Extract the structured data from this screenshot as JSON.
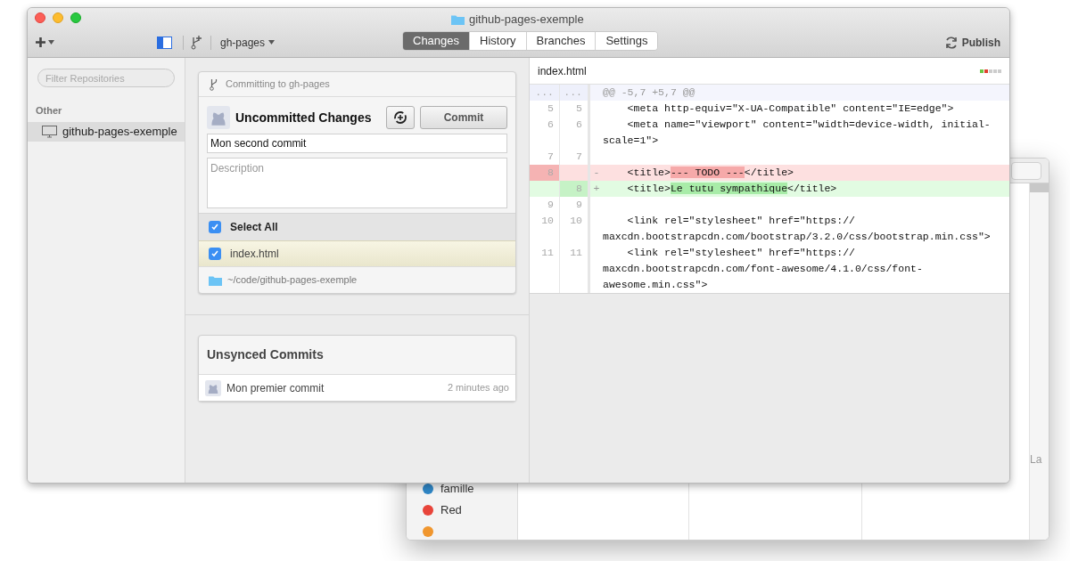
{
  "background_window": {
    "tags": [
      {
        "label": "famille",
        "color": "#2f86c6"
      },
      {
        "label": "Red",
        "color": "#e8443a"
      },
      {
        "color": "#f0962e"
      }
    ],
    "column_text": "La"
  },
  "window": {
    "title": "github-pages-exemple"
  },
  "toolbar": {
    "branch": "gh-pages",
    "tabs": [
      {
        "label": "Changes",
        "selected": true
      },
      {
        "label": "History",
        "selected": false
      },
      {
        "label": "Branches",
        "selected": false
      },
      {
        "label": "Settings",
        "selected": false
      }
    ],
    "publish": "Publish"
  },
  "sidebar": {
    "filter_placeholder": "Filter Repositories",
    "section": "Other",
    "items": [
      {
        "label": "github-pages-exemple",
        "selected": true
      }
    ]
  },
  "commit_panel": {
    "header": "Committing to gh-pages",
    "title": "Uncommitted Changes",
    "commit_button": "Commit",
    "summary": "Mon second commit",
    "description_placeholder": "Description",
    "select_all": {
      "label": "Select All",
      "checked": true
    },
    "files": [
      {
        "name": "index.html",
        "checked": true,
        "selected": true
      }
    ],
    "path": "~/code/github-pages-exemple"
  },
  "unsynced": {
    "title": "Unsynced Commits",
    "commits": [
      {
        "message": "Mon premier commit",
        "time": "2 minutes ago"
      }
    ]
  },
  "diff": {
    "file": "index.html",
    "rows": [
      {
        "kind": "hunk",
        "old": "...",
        "new": "...",
        "lines": [
          [
            {
              "text": "@@ -5,7 +5,7 @@"
            }
          ]
        ]
      },
      {
        "kind": "context",
        "old": "5",
        "new": "5",
        "lines": [
          [
            {
              "text": "    <meta http-equiv=\"X-UA-Compatible\" content=\"IE=edge\">"
            }
          ]
        ]
      },
      {
        "kind": "context",
        "old": "6",
        "new": "6",
        "lines": [
          [
            {
              "text": "    <meta name=\"viewport\" content=\"width=device-width, initial-"
            }
          ],
          [
            {
              "text": "scale=1\">"
            }
          ]
        ]
      },
      {
        "kind": "context",
        "old": "7",
        "new": "7",
        "lines": []
      },
      {
        "kind": "deletion",
        "old": "8",
        "sign": "-",
        "lines": [
          [
            {
              "text": "    <title>"
            },
            {
              "text": "--- TODO ---",
              "highlight": true
            },
            {
              "text": "</title>"
            }
          ]
        ]
      },
      {
        "kind": "addition",
        "new": "8",
        "sign": "+",
        "lines": [
          [
            {
              "text": "    <title>"
            },
            {
              "text": "Le tutu sympathique",
              "highlight": true
            },
            {
              "text": "</title>"
            }
          ]
        ]
      },
      {
        "kind": "context",
        "old": "9",
        "new": "9",
        "lines": []
      },
      {
        "kind": "context",
        "old": "10",
        "new": "10",
        "lines": [
          [
            {
              "text": "    <link rel=\"stylesheet\" href=\"https://"
            }
          ],
          [
            {
              "text": "maxcdn.bootstrapcdn.com/bootstrap/3.2.0/css/bootstrap.min.css\">"
            }
          ]
        ]
      },
      {
        "kind": "context",
        "old": "11",
        "new": "11",
        "lines": [
          [
            {
              "text": "    <link rel=\"stylesheet\" href=\"https://"
            }
          ],
          [
            {
              "text": "maxcdn.bootstrapcdn.com/font-awesome/4.1.0/css/font-"
            }
          ],
          [
            {
              "text": "awesome.min.css\">"
            }
          ]
        ]
      }
    ]
  }
}
